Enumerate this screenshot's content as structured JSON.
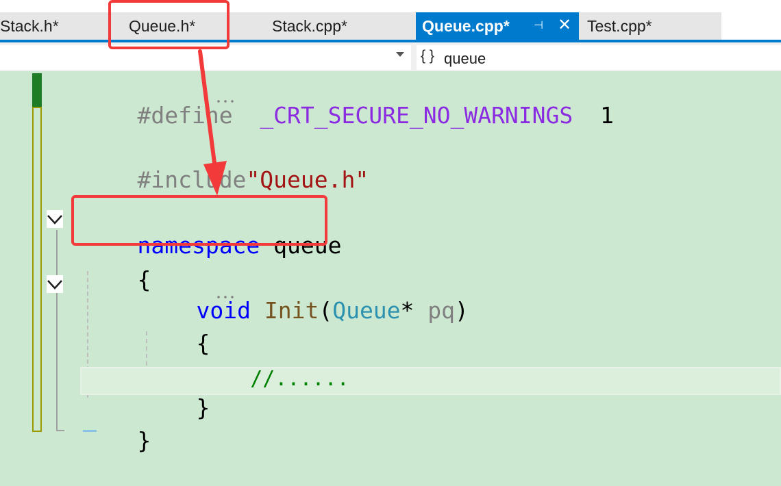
{
  "tabs": [
    {
      "label": "Stack.h*",
      "active": false
    },
    {
      "label": "Queue.h*",
      "active": false
    },
    {
      "label": "Stack.cpp*",
      "active": false
    },
    {
      "label": "Queue.cpp*",
      "active": true
    },
    {
      "label": "Test.cpp*",
      "active": false
    }
  ],
  "active_tab_pin": "⊣",
  "active_tab_close": "✕",
  "nav_bar": {
    "left_dropdown_value": "",
    "scope_icon": "{ }",
    "scope_value": "queue"
  },
  "code": {
    "line1": {
      "directive": "#define",
      "macro": "_CRT_SECURE_NO_WARNINGS",
      "value": "1"
    },
    "line3": {
      "directive": "#include",
      "header": "\"Queue.h\""
    },
    "line5": {
      "keyword": "namespace",
      "name": "queue"
    },
    "line6": {
      "brace": "{"
    },
    "line7": {
      "ret_type": "void",
      "func": "Init",
      "paren_open": "(",
      "param_type": "Queue",
      "star": "*",
      "param": "pq",
      "paren_close": ")"
    },
    "line8": {
      "brace": "{"
    },
    "line9": {
      "comment": "//......"
    },
    "line10": {
      "brace": "}"
    },
    "line11": {
      "brace": "}"
    }
  },
  "colors": {
    "accent": "#007acc",
    "editor_background": "#cde8d0",
    "annotation_red": "#f23a3a"
  },
  "icons": [
    "collapse-chevron-icon",
    "pin-icon",
    "close-icon",
    "dropdown-arrow-icon"
  ]
}
